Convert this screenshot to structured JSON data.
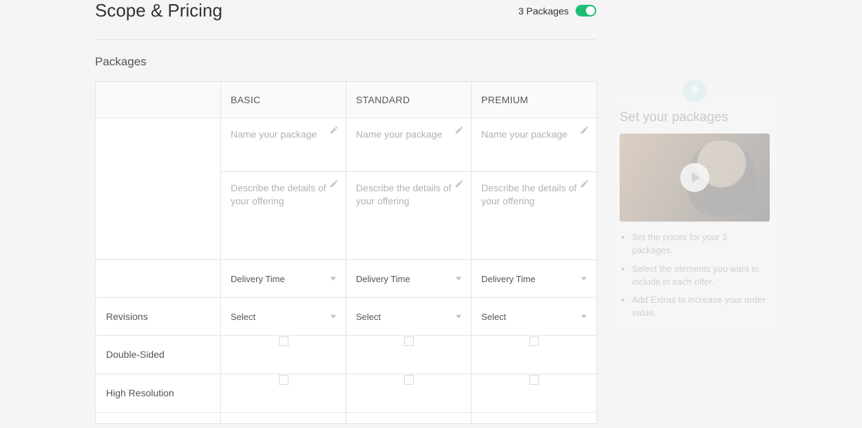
{
  "header": {
    "title": "Scope & Pricing",
    "toggle_label": "3 Packages",
    "toggle_on": true
  },
  "subtitle": "Packages",
  "columns": [
    {
      "label": "BASIC"
    },
    {
      "label": "STANDARD"
    },
    {
      "label": "PREMIUM"
    }
  ],
  "placeholders": {
    "name": "Name your package",
    "desc": "Describe the details of your offering"
  },
  "selects": {
    "delivery": "Delivery Time",
    "revisions": "Select"
  },
  "row_labels": {
    "revisions": "Revisions",
    "double_sided": "Double-Sided",
    "high_res": "High Resolution"
  },
  "tips": {
    "title": "Set your packages",
    "items": [
      "Set the prices for your 3 packages.",
      "Select the elements you want to include in each offer.",
      "Add Extras to increase your order value."
    ]
  }
}
